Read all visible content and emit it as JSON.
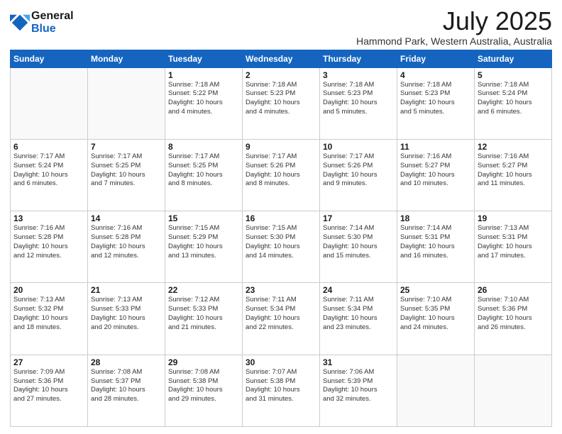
{
  "logo": {
    "line1": "General",
    "line2": "Blue"
  },
  "title": "July 2025",
  "location": "Hammond Park, Western Australia, Australia",
  "weekdays": [
    "Sunday",
    "Monday",
    "Tuesday",
    "Wednesday",
    "Thursday",
    "Friday",
    "Saturday"
  ],
  "weeks": [
    [
      {
        "day": "",
        "detail": ""
      },
      {
        "day": "",
        "detail": ""
      },
      {
        "day": "1",
        "detail": "Sunrise: 7:18 AM\nSunset: 5:22 PM\nDaylight: 10 hours\nand 4 minutes."
      },
      {
        "day": "2",
        "detail": "Sunrise: 7:18 AM\nSunset: 5:23 PM\nDaylight: 10 hours\nand 4 minutes."
      },
      {
        "day": "3",
        "detail": "Sunrise: 7:18 AM\nSunset: 5:23 PM\nDaylight: 10 hours\nand 5 minutes."
      },
      {
        "day": "4",
        "detail": "Sunrise: 7:18 AM\nSunset: 5:23 PM\nDaylight: 10 hours\nand 5 minutes."
      },
      {
        "day": "5",
        "detail": "Sunrise: 7:18 AM\nSunset: 5:24 PM\nDaylight: 10 hours\nand 6 minutes."
      }
    ],
    [
      {
        "day": "6",
        "detail": "Sunrise: 7:17 AM\nSunset: 5:24 PM\nDaylight: 10 hours\nand 6 minutes."
      },
      {
        "day": "7",
        "detail": "Sunrise: 7:17 AM\nSunset: 5:25 PM\nDaylight: 10 hours\nand 7 minutes."
      },
      {
        "day": "8",
        "detail": "Sunrise: 7:17 AM\nSunset: 5:25 PM\nDaylight: 10 hours\nand 8 minutes."
      },
      {
        "day": "9",
        "detail": "Sunrise: 7:17 AM\nSunset: 5:26 PM\nDaylight: 10 hours\nand 8 minutes."
      },
      {
        "day": "10",
        "detail": "Sunrise: 7:17 AM\nSunset: 5:26 PM\nDaylight: 10 hours\nand 9 minutes."
      },
      {
        "day": "11",
        "detail": "Sunrise: 7:16 AM\nSunset: 5:27 PM\nDaylight: 10 hours\nand 10 minutes."
      },
      {
        "day": "12",
        "detail": "Sunrise: 7:16 AM\nSunset: 5:27 PM\nDaylight: 10 hours\nand 11 minutes."
      }
    ],
    [
      {
        "day": "13",
        "detail": "Sunrise: 7:16 AM\nSunset: 5:28 PM\nDaylight: 10 hours\nand 12 minutes."
      },
      {
        "day": "14",
        "detail": "Sunrise: 7:16 AM\nSunset: 5:28 PM\nDaylight: 10 hours\nand 12 minutes."
      },
      {
        "day": "15",
        "detail": "Sunrise: 7:15 AM\nSunset: 5:29 PM\nDaylight: 10 hours\nand 13 minutes."
      },
      {
        "day": "16",
        "detail": "Sunrise: 7:15 AM\nSunset: 5:30 PM\nDaylight: 10 hours\nand 14 minutes."
      },
      {
        "day": "17",
        "detail": "Sunrise: 7:14 AM\nSunset: 5:30 PM\nDaylight: 10 hours\nand 15 minutes."
      },
      {
        "day": "18",
        "detail": "Sunrise: 7:14 AM\nSunset: 5:31 PM\nDaylight: 10 hours\nand 16 minutes."
      },
      {
        "day": "19",
        "detail": "Sunrise: 7:13 AM\nSunset: 5:31 PM\nDaylight: 10 hours\nand 17 minutes."
      }
    ],
    [
      {
        "day": "20",
        "detail": "Sunrise: 7:13 AM\nSunset: 5:32 PM\nDaylight: 10 hours\nand 18 minutes."
      },
      {
        "day": "21",
        "detail": "Sunrise: 7:13 AM\nSunset: 5:33 PM\nDaylight: 10 hours\nand 20 minutes."
      },
      {
        "day": "22",
        "detail": "Sunrise: 7:12 AM\nSunset: 5:33 PM\nDaylight: 10 hours\nand 21 minutes."
      },
      {
        "day": "23",
        "detail": "Sunrise: 7:11 AM\nSunset: 5:34 PM\nDaylight: 10 hours\nand 22 minutes."
      },
      {
        "day": "24",
        "detail": "Sunrise: 7:11 AM\nSunset: 5:34 PM\nDaylight: 10 hours\nand 23 minutes."
      },
      {
        "day": "25",
        "detail": "Sunrise: 7:10 AM\nSunset: 5:35 PM\nDaylight: 10 hours\nand 24 minutes."
      },
      {
        "day": "26",
        "detail": "Sunrise: 7:10 AM\nSunset: 5:36 PM\nDaylight: 10 hours\nand 26 minutes."
      }
    ],
    [
      {
        "day": "27",
        "detail": "Sunrise: 7:09 AM\nSunset: 5:36 PM\nDaylight: 10 hours\nand 27 minutes."
      },
      {
        "day": "28",
        "detail": "Sunrise: 7:08 AM\nSunset: 5:37 PM\nDaylight: 10 hours\nand 28 minutes."
      },
      {
        "day": "29",
        "detail": "Sunrise: 7:08 AM\nSunset: 5:38 PM\nDaylight: 10 hours\nand 29 minutes."
      },
      {
        "day": "30",
        "detail": "Sunrise: 7:07 AM\nSunset: 5:38 PM\nDaylight: 10 hours\nand 31 minutes."
      },
      {
        "day": "31",
        "detail": "Sunrise: 7:06 AM\nSunset: 5:39 PM\nDaylight: 10 hours\nand 32 minutes."
      },
      {
        "day": "",
        "detail": ""
      },
      {
        "day": "",
        "detail": ""
      }
    ]
  ]
}
